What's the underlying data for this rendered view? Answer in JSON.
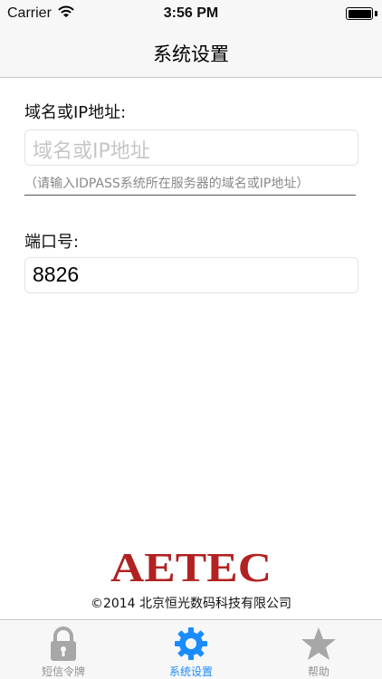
{
  "status_bar": {
    "carrier": "Carrier",
    "time": "3:56 PM"
  },
  "nav": {
    "title": "系统设置"
  },
  "form": {
    "host_label": "域名或IP地址:",
    "host_placeholder": "域名或IP地址",
    "host_hint": "（请输入IDPASS系统所在服务器的域名或IP地址）",
    "port_label": "端口号:",
    "port_value": "8826"
  },
  "footer": {
    "logo_text": "AETEC",
    "copyright": "©2014 北京恒光数码科技有限公司"
  },
  "tabs": [
    {
      "label": "短信令牌",
      "icon": "lock-icon",
      "active": false
    },
    {
      "label": "系统设置",
      "icon": "gear-icon",
      "active": true
    },
    {
      "label": "帮助",
      "icon": "star-icon",
      "active": false
    }
  ],
  "colors": {
    "accent": "#1a8cff",
    "tab_inactive": "#929292",
    "logo_red": "#b22222",
    "bar_background": "#f7f7f7"
  }
}
